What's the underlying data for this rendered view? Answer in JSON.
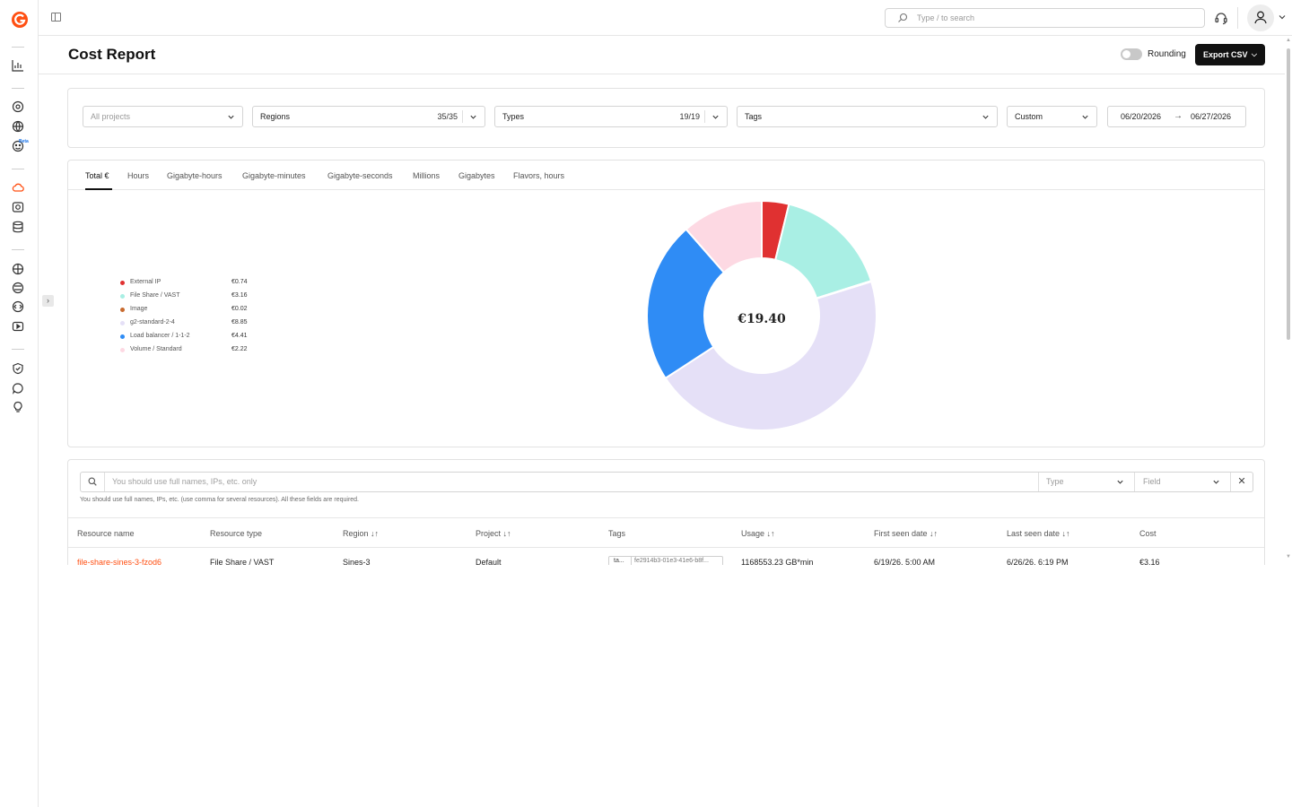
{
  "app": {
    "search_placeholder": "Type / to search"
  },
  "header": {
    "title": "Cost Report",
    "rounding_label": "Rounding",
    "rounding_on": false,
    "export_label": "Export CSV"
  },
  "filters": {
    "projects_placeholder": "All projects",
    "regions_label": "Regions",
    "regions_count": "35/35",
    "types_label": "Types",
    "types_count": "19/19",
    "tags_label": "Tags",
    "period_label": "Custom",
    "date_from": "06/20/2026",
    "date_to": "06/27/2026"
  },
  "tabs": [
    "Total €",
    "Hours",
    "Gigabyte-hours",
    "Gigabyte-minutes",
    "Gigabyte-seconds",
    "Millions",
    "Gigabytes",
    "Flavors, hours"
  ],
  "active_tab": 0,
  "chart_total": "€19.40",
  "legend": [
    {
      "name": "External IP",
      "value": "€0.74",
      "color": "#e03131"
    },
    {
      "name": "File Share / VAST",
      "value": "€3.16",
      "color": "#a9efe4"
    },
    {
      "name": "Image",
      "value": "€0.02",
      "color": "#c86a2e"
    },
    {
      "name": "g2-standard-2-4",
      "value": "€8.85",
      "color": "#e5e0f7"
    },
    {
      "name": "Load balancer / 1-1-2",
      "value": "€4.41",
      "color": "#2f8cf5"
    },
    {
      "name": "Volume / Standard",
      "value": "€2.22",
      "color": "#fdd9e3"
    }
  ],
  "chart_data": {
    "type": "pie",
    "categories": [
      "External IP",
      "File Share / VAST",
      "Image",
      "g2-standard-2-4",
      "Load balancer / 1-1-2",
      "Volume / Standard"
    ],
    "values": [
      0.74,
      3.16,
      0.02,
      8.85,
      4.41,
      2.22
    ],
    "colors": [
      "#e03131",
      "#a9efe4",
      "#c86a2e",
      "#e5e0f7",
      "#2f8cf5",
      "#fdd9e3"
    ],
    "center_label": "€19.40",
    "legend_position": "left"
  },
  "resources": {
    "search_placeholder": "You should use full names, IPs, etc. only",
    "type_placeholder": "Type",
    "field_placeholder": "Field",
    "clear_glyph": "✕",
    "hint": "You should use full names, IPs, etc. (use comma for several resources). All these fields are required.",
    "columns": [
      "Resource name",
      "Resource type",
      "Region ↓↑",
      "Project ↓↑",
      "Tags",
      "Usage ↓↑",
      "First seen date ↓↑",
      "Last seen date ↓↑",
      "Cost"
    ],
    "rows": [
      {
        "name": "file-share-sines-3-fzod6",
        "type": "File Share / VAST",
        "region": "Sines-3",
        "project": "Default",
        "tag_key": "ta...",
        "tag_value": "fe2914b3-01e3-41e6-b8f...",
        "usage": "1168553.23 GB*min",
        "first_seen": "6/19/26, 5:00 AM",
        "last_seen": "6/26/26, 6:19 PM",
        "cost": "€3.16"
      }
    ]
  }
}
